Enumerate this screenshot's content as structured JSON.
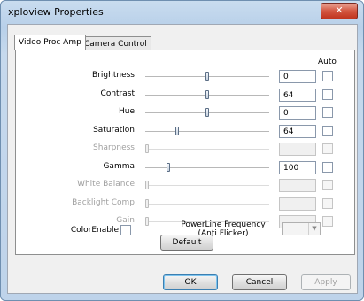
{
  "window": {
    "title": "xploview Properties",
    "close_glyph": "✕"
  },
  "tabs": [
    {
      "label": "Video Proc Amp"
    },
    {
      "label": "Camera Control"
    }
  ],
  "auto_header": "Auto",
  "controls": [
    {
      "label": "Brightness",
      "value": "0",
      "level": 0.5
    },
    {
      "label": "Contrast",
      "value": "64",
      "level": 0.5
    },
    {
      "label": "Hue",
      "value": "0",
      "level": 0.5
    },
    {
      "label": "Saturation",
      "value": "64",
      "level": 0.25
    },
    {
      "label": "Sharpness",
      "value": "",
      "level": 0.0,
      "disabled": true
    },
    {
      "label": "Gamma",
      "value": "100",
      "level": 0.18
    },
    {
      "label": "White Balance",
      "value": "",
      "level": 0.0,
      "disabled": true
    },
    {
      "label": "Backlight Comp",
      "value": "",
      "level": 0.0,
      "disabled": true
    },
    {
      "label": "Gain",
      "value": "",
      "level": 0.0,
      "disabled": true
    }
  ],
  "color_enable_label": "ColorEnable",
  "powerline": {
    "label_line1": "PowerLine Frequency",
    "label_line2": "(Anti Flicker)",
    "value": ""
  },
  "buttons": {
    "default": "Default",
    "ok": "OK",
    "cancel": "Cancel",
    "apply": "Apply"
  }
}
